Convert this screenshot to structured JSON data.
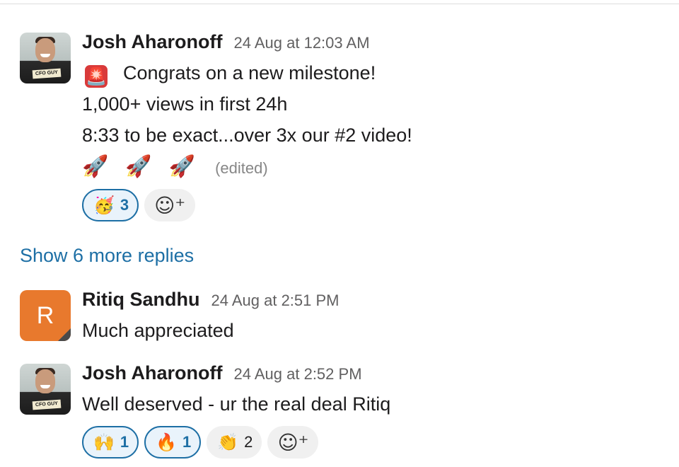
{
  "thread": [
    {
      "author": "Josh Aharonoff",
      "time": "24 Aug at 12:03 AM",
      "avatar_badge": "CFO GUY",
      "lines": [
        "Congrats on a new milestone!",
        "1,000+ views in first 24h",
        "8:33 to be exact...over 3x our #2 video!"
      ],
      "lead_emoji": "🚨",
      "rockets": [
        "🚀",
        "🚀",
        "🚀"
      ],
      "edited_label": "(edited)",
      "reactions": [
        {
          "emoji": "🥳",
          "count": "3",
          "active": true
        }
      ]
    },
    {
      "show_more": "Show 6 more replies"
    },
    {
      "author": "Ritiq Sandhu",
      "time": "24 Aug at 2:51 PM",
      "avatar_letter": "R",
      "lines": [
        "Much appreciated"
      ]
    },
    {
      "author": "Josh Aharonoff",
      "time": "24 Aug at 2:52 PM",
      "avatar_badge": "CFO GUY",
      "lines": [
        "Well deserved - ur the real deal Ritiq"
      ],
      "reactions": [
        {
          "emoji": "🙌",
          "count": "1",
          "active": true
        },
        {
          "emoji": "🔥",
          "count": "1",
          "active": true
        },
        {
          "emoji": "👏",
          "count": "2",
          "active": false
        }
      ]
    }
  ],
  "icons": {
    "add_reaction": "add-reaction-icon"
  },
  "colors": {
    "link": "#1d6fa5",
    "reaction_active_bg": "#e9f3fb",
    "avatar_orange": "#e8792d"
  }
}
